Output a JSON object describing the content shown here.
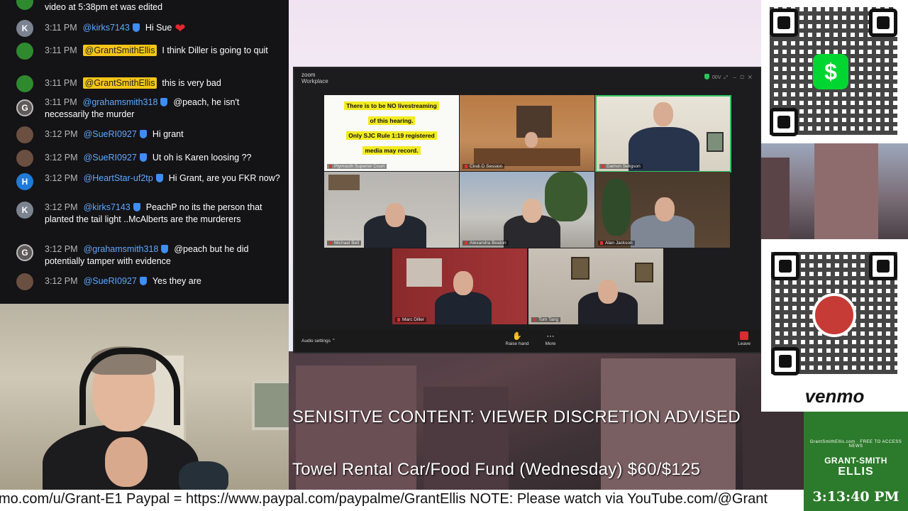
{
  "chat": {
    "messages": [
      {
        "avatar": "",
        "time": "",
        "user": "",
        "text": "video at 5:38pm et was edited",
        "avatar_type": "g"
      },
      {
        "avatar": "K",
        "time": "3:11 PM",
        "user": "@kirks7143",
        "text": "Hi Sue",
        "avatar_type": "k",
        "heart": true
      },
      {
        "avatar": "",
        "time": "3:11 PM",
        "user": "@GrantSmithEllis",
        "text": "I think Diller is going to quit",
        "avatar_type": "g",
        "highlight": true
      },
      {
        "avatar": "",
        "time": "3:11 PM",
        "user": "@GrantSmithEllis",
        "text": "this is very bad",
        "avatar_type": "g",
        "highlight": true
      },
      {
        "avatar": "G",
        "time": "3:11 PM",
        "user": "@grahamsmith318",
        "text": "@peach, he isn't necessarily the murder",
        "avatar_type": "gr"
      },
      {
        "avatar": "",
        "time": "3:12 PM",
        "user": "@SueRI0927",
        "text": "Hi grant",
        "avatar_type": "s"
      },
      {
        "avatar": "",
        "time": "3:12 PM",
        "user": "@SueRI0927",
        "text": "Ut oh is Karen loosing ??",
        "avatar_type": "s"
      },
      {
        "avatar": "H",
        "time": "3:12 PM",
        "user": "@HeartStar-uf2tp",
        "text": "Hi Grant, are you FKR now?",
        "avatar_type": "h"
      },
      {
        "avatar": "K",
        "time": "3:12 PM",
        "user": "@kirks7143",
        "text": "PeachP no its the person that planted the tail light ..McAlberts are the murderers",
        "avatar_type": "k"
      },
      {
        "avatar": "G",
        "time": "3:12 PM",
        "user": "@grahamsmith318",
        "text": "@peach but he did potentially tamper with evidence",
        "avatar_type": "gr"
      },
      {
        "avatar": "",
        "time": "3:12 PM",
        "user": "@SueRI0927",
        "text": "Yes they are",
        "avatar_type": "s"
      }
    ]
  },
  "zoom": {
    "app": "zoom",
    "title": "Workplace",
    "ctl": "00V",
    "notice_lines": [
      "There is to be NO livestreaming",
      "of this hearing.",
      "Only SJC Rule 1:19 registered",
      "media may record."
    ],
    "participants": [
      "Plymouth Superior Court",
      "Cindi D Session",
      "Damon Seligson",
      "Michael Bell",
      "Alexandra Beaton",
      "Alan Jackson",
      "Marc Diller",
      "Tom Tang"
    ],
    "toolbar": {
      "audio_settings": "Audio settings",
      "raise_hand": "Raise hand",
      "more": "More",
      "leave": "Leave"
    }
  },
  "overlays": {
    "warning": "SENISITVE CONTENT: VIEWER DISCRETION ADVISED",
    "fund": "Towel Rental Car/Food Fund (Wednesday) $60/$125",
    "ticker": "mo.com/u/Grant-E1 Paypal = https://www.paypal.com/paypalme/GrantEllis NOTE: Please watch via YouTube.com/@Grant"
  },
  "payments": {
    "cashapp_symbol": "$",
    "venmo_label": "venmo"
  },
  "logo": {
    "small": "GrantSmithEllis.com · FREE TO ACCESS NEWS",
    "name1": "GRANT-SMITH",
    "name2": "ELLIS"
  },
  "clock": "3:13:40 PM",
  "colors": {
    "chat_bg": "#141316",
    "user_link": "#5ea9ff",
    "highlight": "#f5c518",
    "cashapp": "#00d632",
    "logo_green": "#2c7a2b"
  }
}
